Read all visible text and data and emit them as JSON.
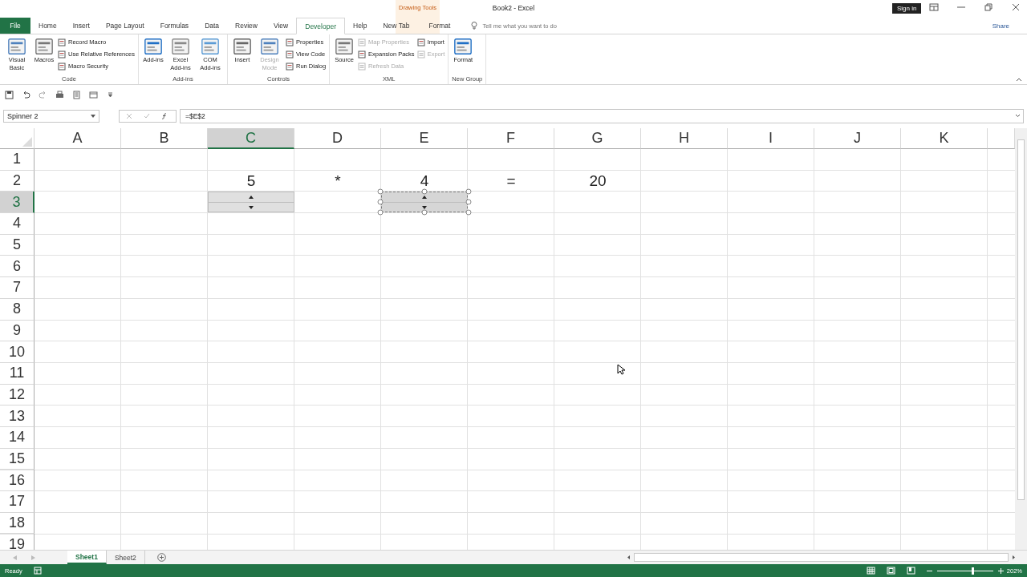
{
  "window": {
    "title": "Book2 - Excel",
    "contextual_label": "Drawing Tools",
    "sign_in": "Sign in"
  },
  "tabs": [
    {
      "label": "File",
      "kind": "file",
      "selected": false
    },
    {
      "label": "Home",
      "kind": "normal",
      "selected": false
    },
    {
      "label": "Insert",
      "kind": "normal",
      "selected": false
    },
    {
      "label": "Page Layout",
      "kind": "normal",
      "selected": false
    },
    {
      "label": "Formulas",
      "kind": "normal",
      "selected": false
    },
    {
      "label": "Data",
      "kind": "normal",
      "selected": false
    },
    {
      "label": "Review",
      "kind": "normal",
      "selected": false
    },
    {
      "label": "View",
      "kind": "normal",
      "selected": false
    },
    {
      "label": "Developer",
      "kind": "normal",
      "selected": true
    },
    {
      "label": "Help",
      "kind": "normal",
      "selected": false
    },
    {
      "label": "New Tab",
      "kind": "normal",
      "selected": false
    },
    {
      "label": "Format",
      "kind": "contextual",
      "selected": false
    }
  ],
  "tell_me": {
    "placeholder": "Tell me what you want to do"
  },
  "share": "Share",
  "ribbon_groups": [
    {
      "label": "Code",
      "items": [
        {
          "label": "Visual Basic",
          "kind": "large",
          "disabled": false
        },
        {
          "label": "Macros",
          "kind": "large",
          "disabled": false
        },
        {
          "kind": "stack",
          "children": [
            {
              "label": "Record Macro",
              "disabled": false
            },
            {
              "label": "Use Relative References",
              "disabled": false
            },
            {
              "label": "Macro Security",
              "disabled": false
            }
          ]
        }
      ]
    },
    {
      "label": "Add-ins",
      "items": [
        {
          "label": "Add-ins",
          "kind": "large",
          "disabled": false
        },
        {
          "label": "Excel Add-ins",
          "kind": "large",
          "disabled": false
        },
        {
          "label": "COM Add-ins",
          "kind": "large",
          "disabled": false
        }
      ]
    },
    {
      "label": "Controls",
      "items": [
        {
          "label": "Insert",
          "kind": "large",
          "disabled": false
        },
        {
          "label": "Design Mode",
          "kind": "large",
          "disabled": true
        },
        {
          "kind": "stack",
          "children": [
            {
              "label": "Properties",
              "disabled": false
            },
            {
              "label": "View Code",
              "disabled": false
            },
            {
              "label": "Run Dialog",
              "disabled": false
            }
          ]
        }
      ]
    },
    {
      "label": "XML",
      "items": [
        {
          "label": "Source",
          "kind": "large",
          "disabled": false
        },
        {
          "kind": "stack",
          "children": [
            {
              "label": "Map Properties",
              "disabled": true
            },
            {
              "label": "Expansion Packs",
              "disabled": false
            },
            {
              "label": "Refresh Data",
              "disabled": true
            }
          ]
        },
        {
          "kind": "stack",
          "children": [
            {
              "label": "Import",
              "disabled": false
            },
            {
              "label": "Export",
              "disabled": true
            }
          ]
        }
      ]
    },
    {
      "label": "New Group",
      "items": [
        {
          "label": "Format",
          "kind": "large",
          "disabled": false
        }
      ]
    }
  ],
  "name_box": "Spinner 2",
  "formula": "=$E$2",
  "columns": [
    {
      "label": "A",
      "selected": false
    },
    {
      "label": "B",
      "selected": false
    },
    {
      "label": "C",
      "selected": true
    },
    {
      "label": "D",
      "selected": false
    },
    {
      "label": "E",
      "selected": false
    },
    {
      "label": "F",
      "selected": false
    },
    {
      "label": "G",
      "selected": false
    },
    {
      "label": "H",
      "selected": false
    },
    {
      "label": "I",
      "selected": false
    },
    {
      "label": "J",
      "selected": false
    },
    {
      "label": "K",
      "selected": false
    }
  ],
  "rows": [
    {
      "label": "1",
      "selected": false
    },
    {
      "label": "2",
      "selected": false,
      "cells": [
        null,
        null,
        {
          "kind": "text",
          "value": "5"
        },
        {
          "kind": "text",
          "value": "*"
        },
        {
          "kind": "text",
          "value": "4"
        },
        {
          "kind": "text",
          "value": "="
        },
        {
          "kind": "text",
          "value": "20"
        }
      ]
    },
    {
      "label": "3",
      "selected": true,
      "cells": [
        null,
        null,
        {
          "kind": "spinner",
          "selected": false
        },
        null,
        {
          "kind": "spinner",
          "selected": true
        }
      ]
    },
    {
      "label": "4",
      "selected": false
    },
    {
      "label": "5",
      "selected": false
    },
    {
      "label": "6",
      "selected": false
    },
    {
      "label": "7",
      "selected": false
    },
    {
      "label": "8",
      "selected": false
    },
    {
      "label": "9",
      "selected": false
    },
    {
      "label": "10",
      "selected": false
    },
    {
      "label": "11",
      "selected": false
    },
    {
      "label": "12",
      "selected": false
    },
    {
      "label": "13",
      "selected": false
    },
    {
      "label": "14",
      "selected": false
    },
    {
      "label": "15",
      "selected": false
    },
    {
      "label": "16",
      "selected": false
    },
    {
      "label": "17",
      "selected": false
    },
    {
      "label": "18",
      "selected": false
    },
    {
      "label": "19",
      "selected": false
    }
  ],
  "sheets": [
    {
      "label": "Sheet1",
      "selected": true
    },
    {
      "label": "Sheet2",
      "selected": false
    }
  ],
  "status": {
    "text": "Ready",
    "zoom": "202%",
    "level": 0.62
  }
}
